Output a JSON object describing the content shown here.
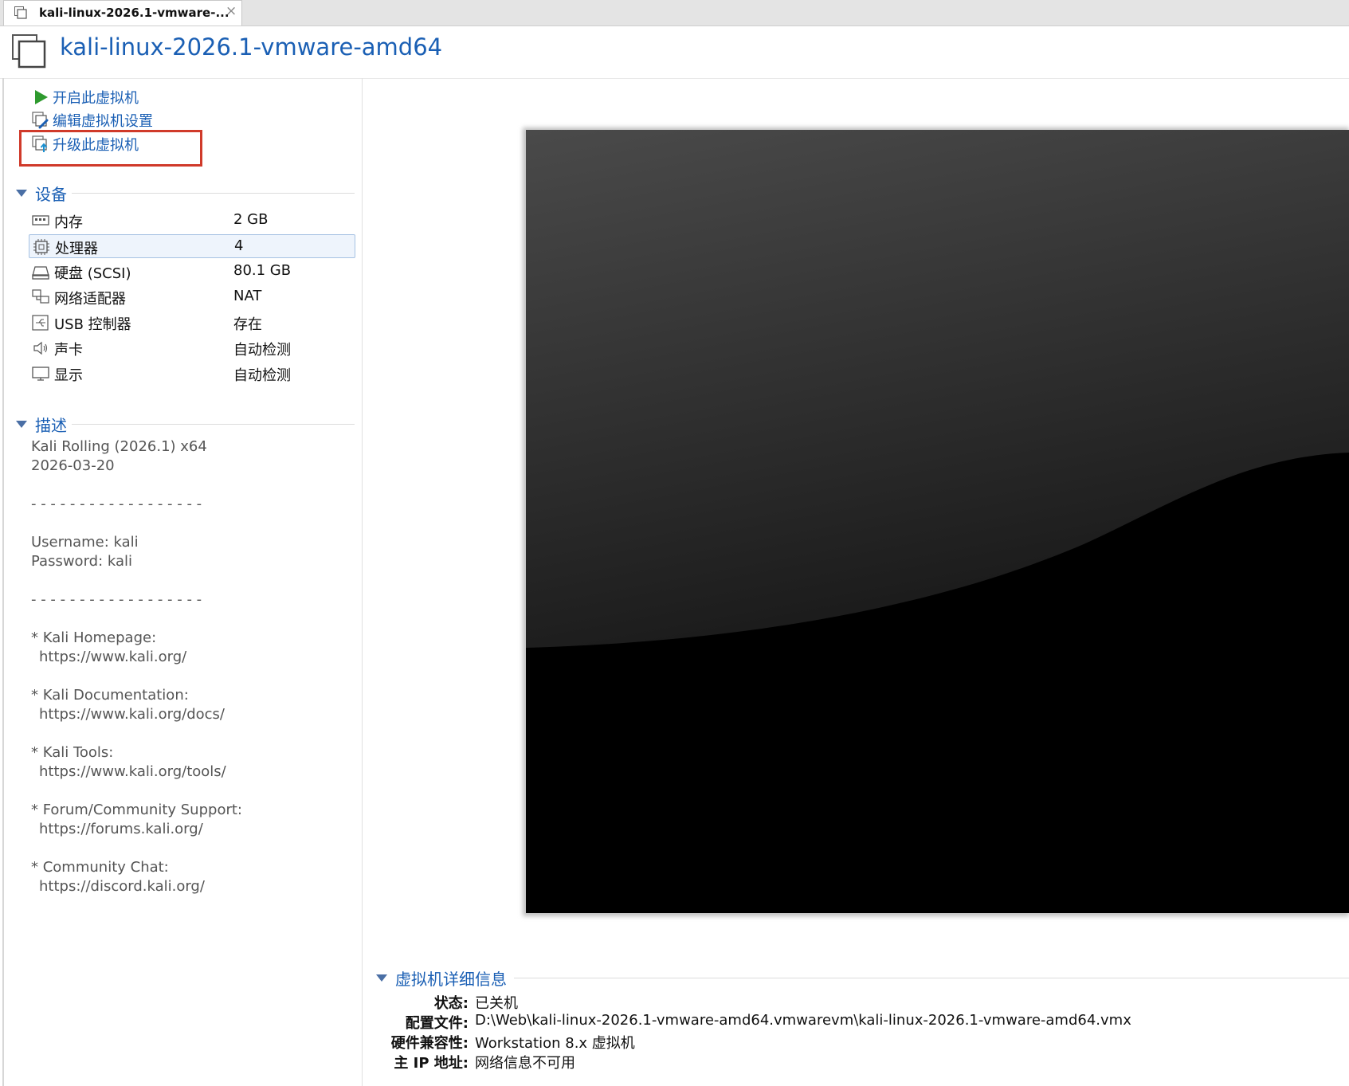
{
  "tab": {
    "title": "kali-linux-2026.1-vmware-...",
    "close": "×"
  },
  "header": {
    "title": "kali-linux-2026.1-vmware-amd64"
  },
  "actions": [
    {
      "label": "开启此虚拟机",
      "icon": "play-icon"
    },
    {
      "label": "编辑虚拟机设置",
      "icon": "edit-settings-icon"
    },
    {
      "label": "升级此虚拟机",
      "icon": "upgrade-icon"
    }
  ],
  "devices": {
    "title": "设备",
    "items": [
      {
        "name": "内存",
        "value": "2 GB",
        "icon": "memory-icon"
      },
      {
        "name": "处理器",
        "value": "4",
        "icon": "processor-icon",
        "selected": true
      },
      {
        "name": "硬盘 (SCSI)",
        "value": "80.1 GB",
        "icon": "hard-disk-icon"
      },
      {
        "name": "网络适配器",
        "value": "NAT",
        "icon": "network-adapter-icon"
      },
      {
        "name": "USB 控制器",
        "value": "存在",
        "icon": "usb-icon"
      },
      {
        "name": "声卡",
        "value": "自动检测",
        "icon": "speaker-icon"
      },
      {
        "name": "显示",
        "value": "自动检测",
        "icon": "monitor-icon"
      }
    ]
  },
  "description": {
    "title": "描述",
    "lines": [
      "Kali Rolling (2026.1) x64",
      "2026-03-20",
      "- - - - - - - - - - - - - - - - - -",
      "Username: kali",
      "Password: kali",
      "- - - - - - - - - - - - - - - - - -",
      "* Kali Homepage:",
      "https://www.kali.org/",
      "* Kali Documentation:",
      "https://www.kali.org/docs/",
      "* Kali Tools:",
      "https://www.kali.org/tools/",
      "* Forum/Community Support:",
      "https://forums.kali.org/",
      "* Community Chat:",
      "https://discord.kali.org/"
    ]
  },
  "details": {
    "title": "虚拟机详细信息",
    "rows": [
      {
        "label": "状态:",
        "value": "已关机"
      },
      {
        "label": "配置文件:",
        "value": "D:\\Web\\kali-linux-2026.1-vmware-amd64.vmwarevm\\kali-linux-2026.1-vmware-amd64.vmx"
      },
      {
        "label": "硬件兼容性:",
        "value": "Workstation 8.x 虚拟机"
      },
      {
        "label": "主 IP 地址:",
        "value": "网络信息不可用"
      }
    ]
  },
  "colors": {
    "link": "#1a5fb4",
    "highlight_box": "#d03a2a",
    "play": "#2e9a2e"
  }
}
